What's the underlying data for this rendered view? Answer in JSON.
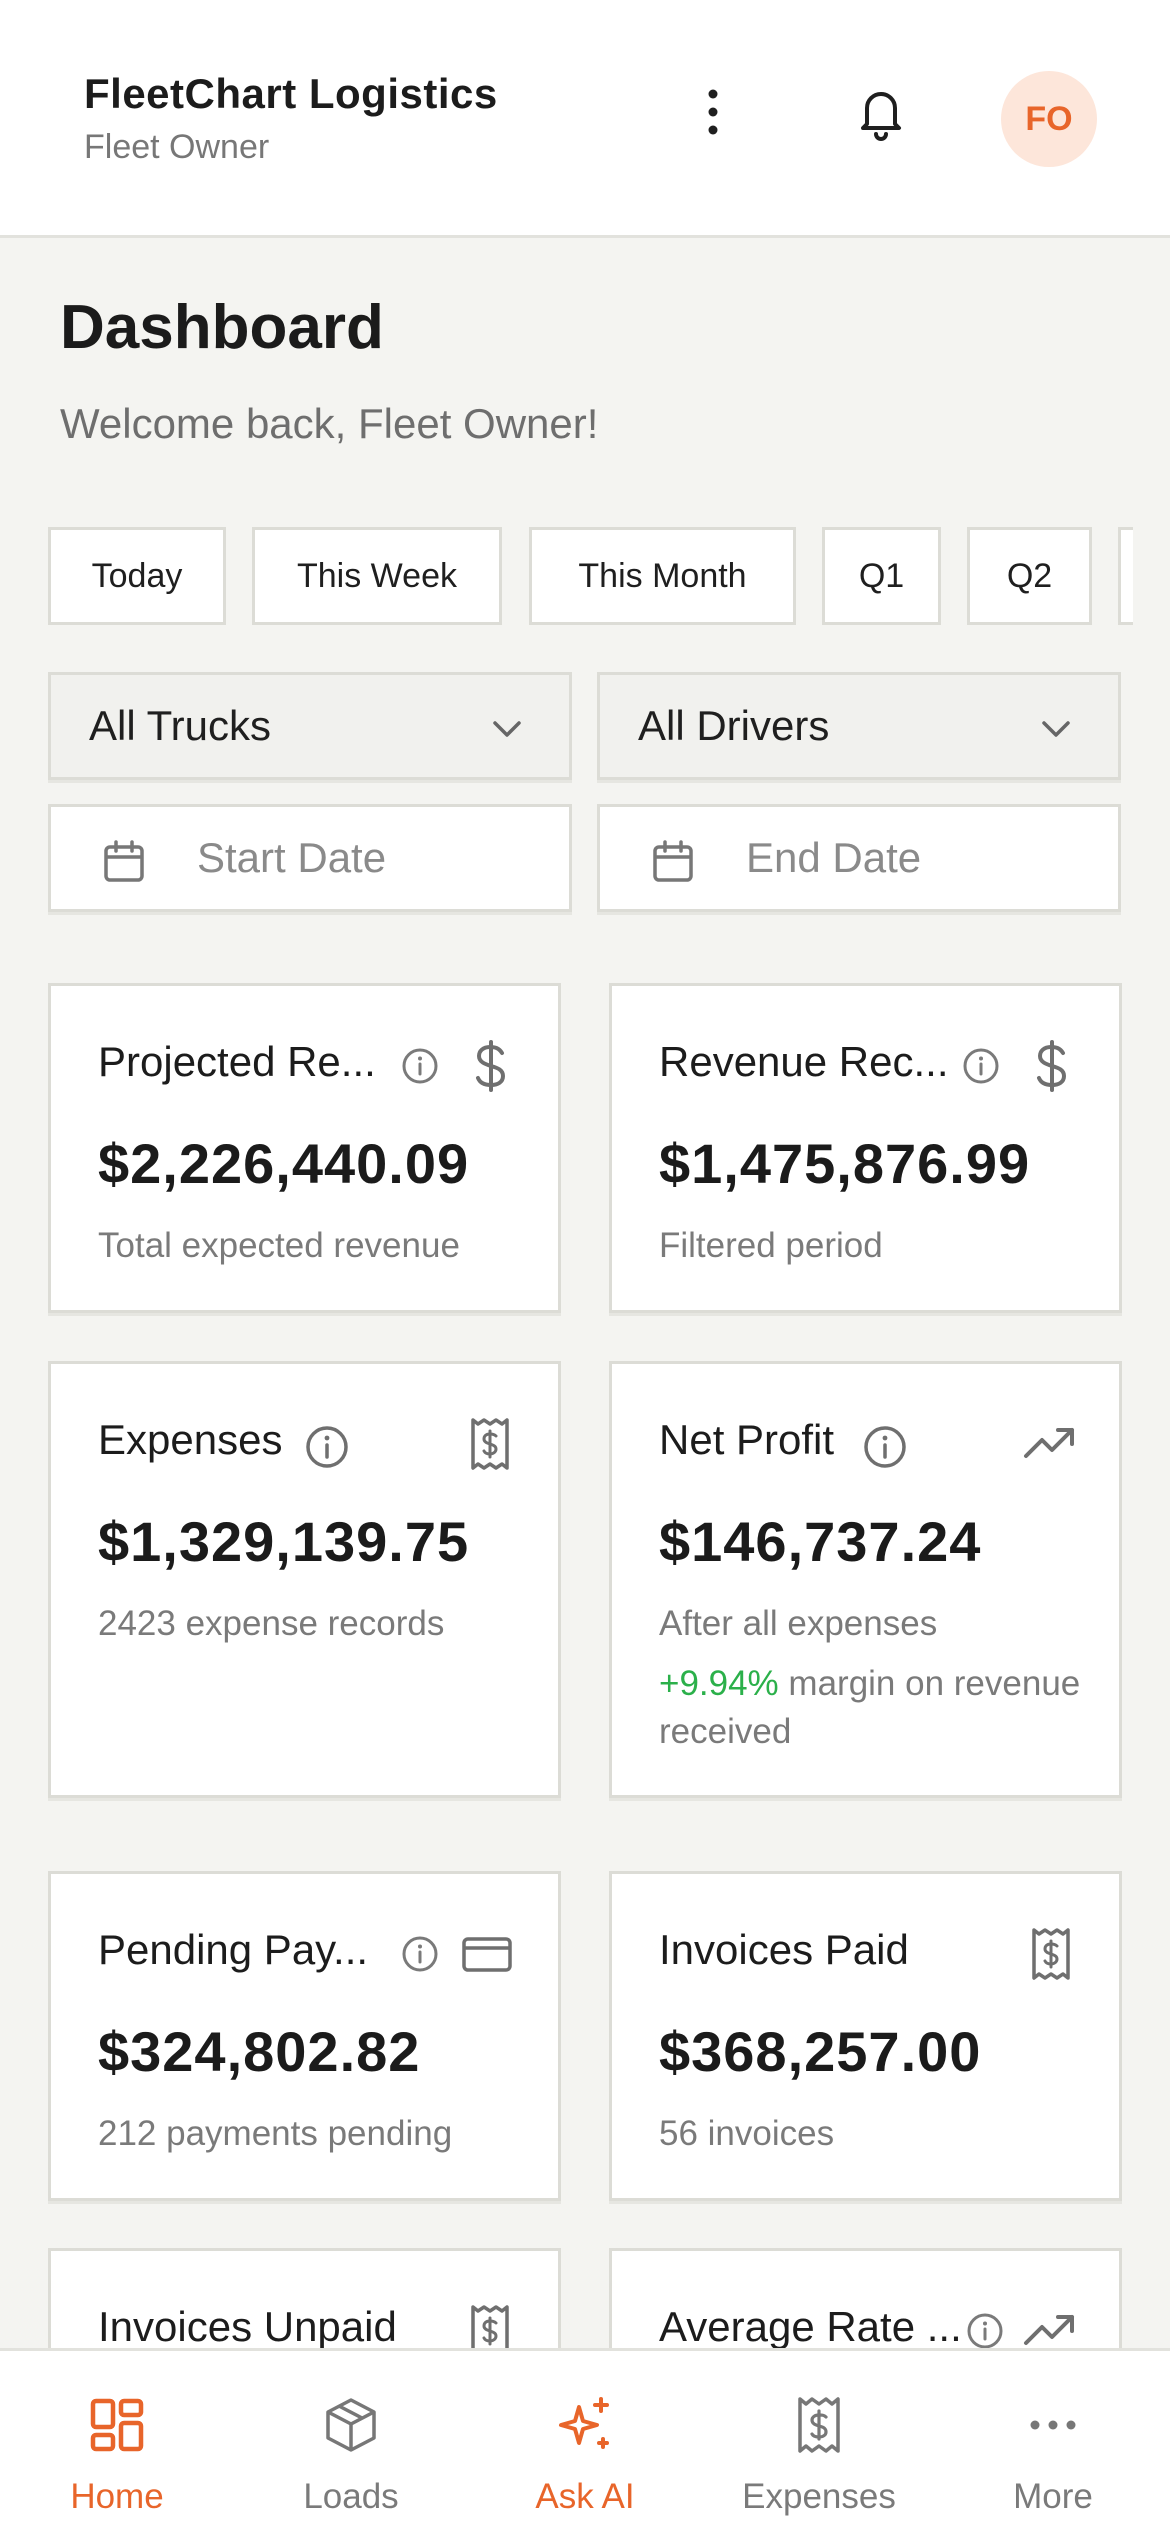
{
  "header": {
    "company": "FleetChart Logistics",
    "role": "Fleet Owner",
    "avatar_initials": "FO"
  },
  "page": {
    "title": "Dashboard",
    "welcome": "Welcome back, Fleet Owner!"
  },
  "periods": [
    "Today",
    "This Week",
    "This Month",
    "Q1",
    "Q2"
  ],
  "filters": {
    "truck": "All Trucks",
    "driver": "All Drivers",
    "start_placeholder": "Start Date",
    "end_placeholder": "End Date"
  },
  "cards": [
    {
      "title": "Projected Re...",
      "value": "$2,226,440.09",
      "sub": "Total expected revenue",
      "icon": "dollar-icon",
      "info": true
    },
    {
      "title": "Revenue Rec...",
      "value": "$1,475,876.99",
      "sub": "Filtered period",
      "icon": "dollar-icon",
      "info": true
    },
    {
      "title": "Expenses",
      "value": "$1,329,139.75",
      "sub": "2423 expense records",
      "icon": "receipt-icon",
      "info": true
    },
    {
      "title": "Net Profit",
      "value": "$146,737.24",
      "sub": "After all expenses",
      "margin_value": "+9.94%",
      "margin_text": " margin on revenue received",
      "icon": "trending-up-icon",
      "info": true
    },
    {
      "title": "Pending Pay...",
      "value": "$324,802.82",
      "sub": "212 payments pending",
      "icon": "credit-card-icon",
      "info": true
    },
    {
      "title": "Invoices Paid",
      "value": "$368,257.00",
      "sub": "56 invoices",
      "icon": "receipt-icon",
      "info": false
    },
    {
      "title": "Invoices Unpaid",
      "icon": "receipt-icon",
      "info": false
    },
    {
      "title": "Average Rate ...",
      "icon": "trending-up-icon",
      "info": true
    }
  ],
  "nav": [
    {
      "label": "Home",
      "icon": "home-grid-icon",
      "active": true
    },
    {
      "label": "Loads",
      "icon": "box-icon",
      "active": false
    },
    {
      "label": "Ask AI",
      "icon": "sparkles-icon",
      "active": true
    },
    {
      "label": "Expenses",
      "icon": "receipt-icon",
      "active": false
    },
    {
      "label": "More",
      "icon": "more-horizontal-icon",
      "active": false
    }
  ],
  "colors": {
    "accent": "#e8652a",
    "positive": "#2bb04a",
    "background": "#f4f4f1",
    "card_border": "#dcdcd6"
  }
}
